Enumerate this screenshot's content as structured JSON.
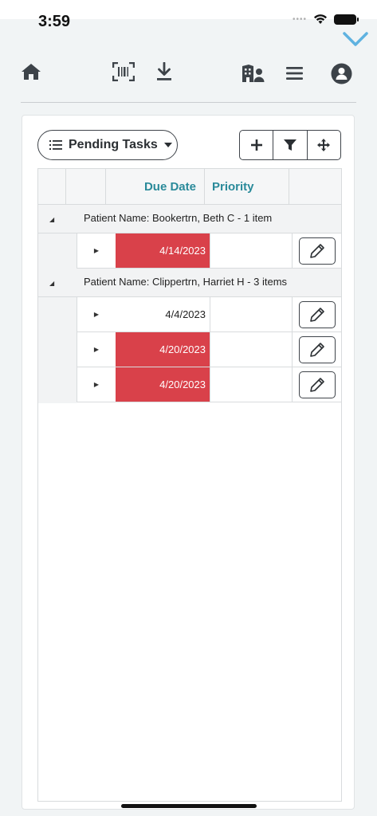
{
  "status_bar": {
    "time": "3:59",
    "signal": "••••"
  },
  "toolbar": {
    "icons": [
      "home-icon",
      "barcode-scan-icon",
      "download-icon",
      "building-person-icon",
      "menu-icon",
      "user-avatar-icon"
    ]
  },
  "view_selector": {
    "label": "Pending Tasks"
  },
  "grid": {
    "columns": [
      "",
      "",
      "Due Date",
      "Priority",
      ""
    ],
    "groups": [
      {
        "header": "Patient Name: Bookertrn, Beth C - 1 item",
        "rows": [
          {
            "due_date": "4/14/2023",
            "priority": "",
            "overdue": true
          }
        ]
      },
      {
        "header": "Patient Name: Clippertrn, Harriet H - 3 items",
        "rows": [
          {
            "due_date": "4/4/2023",
            "priority": "",
            "overdue": false
          },
          {
            "due_date": "4/20/2023",
            "priority": "",
            "overdue": true
          },
          {
            "due_date": "4/20/2023",
            "priority": "",
            "overdue": true
          }
        ]
      }
    ]
  },
  "colors": {
    "accent": "#2a8a9a",
    "overdue": "#d9414a",
    "check": "#5fb2e0"
  }
}
